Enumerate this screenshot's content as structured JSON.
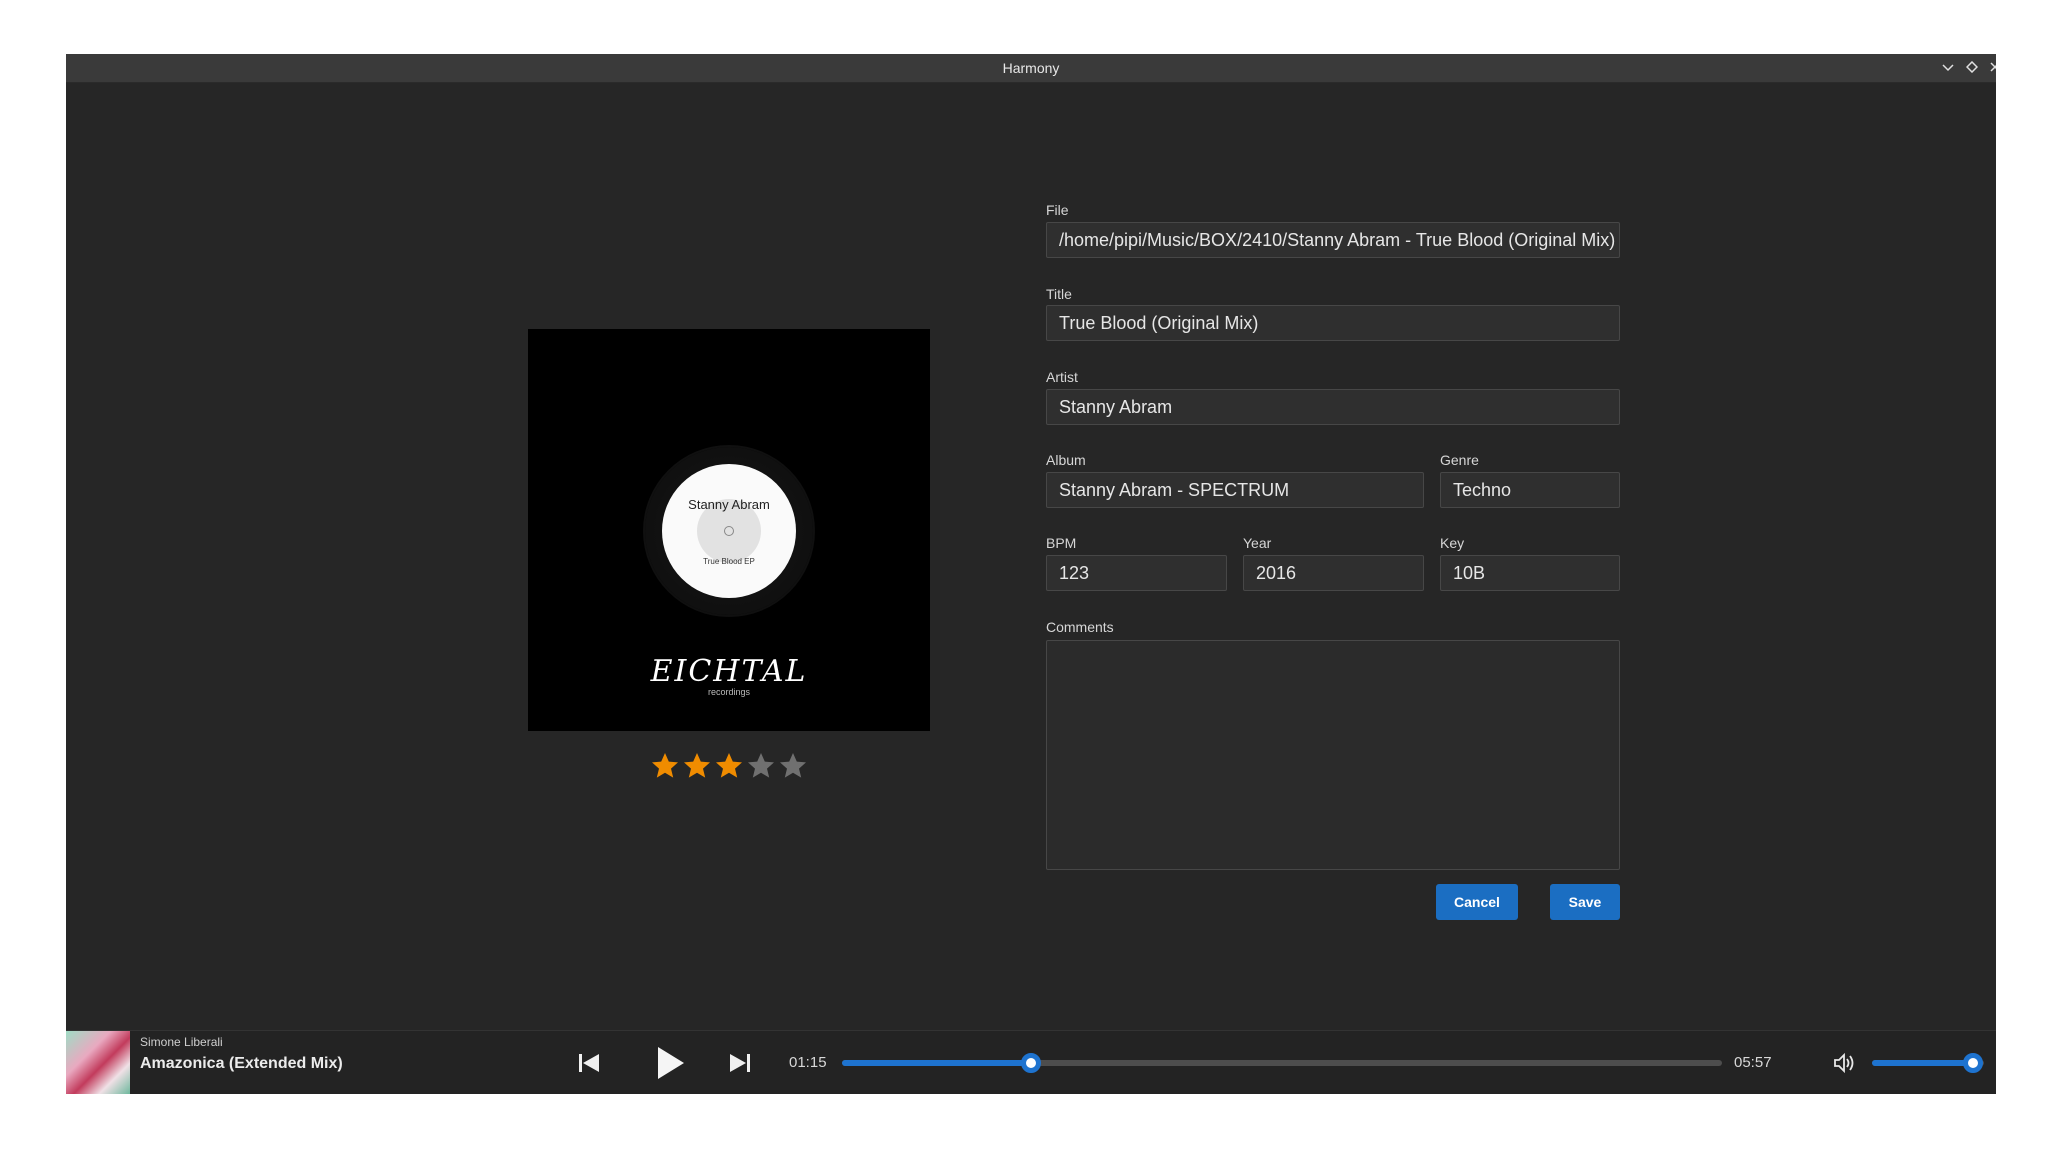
{
  "window": {
    "title": "Harmony",
    "controls": [
      "minimize-icon",
      "maximize-icon",
      "close-icon"
    ]
  },
  "cover": {
    "record_artist": "Stanny Abram",
    "record_release": "True Blood EP",
    "label_logo": "EICHTAL",
    "label_sub": "recordings"
  },
  "rating": {
    "value": 3,
    "max": 5,
    "filled_color": "#f08c00",
    "empty_color": "#707070"
  },
  "form": {
    "file": {
      "label": "File",
      "value": "/home/pipi/Music/BOX/2410/Stanny Abram - True Blood (Original Mix)"
    },
    "title": {
      "label": "Title",
      "value": "True Blood (Original Mix)"
    },
    "artist": {
      "label": "Artist",
      "value": "Stanny Abram"
    },
    "album": {
      "label": "Album",
      "value": "Stanny Abram - SPECTRUM"
    },
    "genre": {
      "label": "Genre",
      "value": "Techno"
    },
    "bpm": {
      "label": "BPM",
      "value": "123"
    },
    "year": {
      "label": "Year",
      "value": "2016"
    },
    "key": {
      "label": "Key",
      "value": "10B"
    },
    "comments": {
      "label": "Comments",
      "value": ""
    },
    "cancel_label": "Cancel",
    "save_label": "Save"
  },
  "player": {
    "artist": "Simone Liberali",
    "title": "Amazonica (Extended Mix)",
    "elapsed": "01:15",
    "duration": "05:57",
    "progress": 0.215,
    "volume": 0.9,
    "accent": "#1e73cf"
  }
}
